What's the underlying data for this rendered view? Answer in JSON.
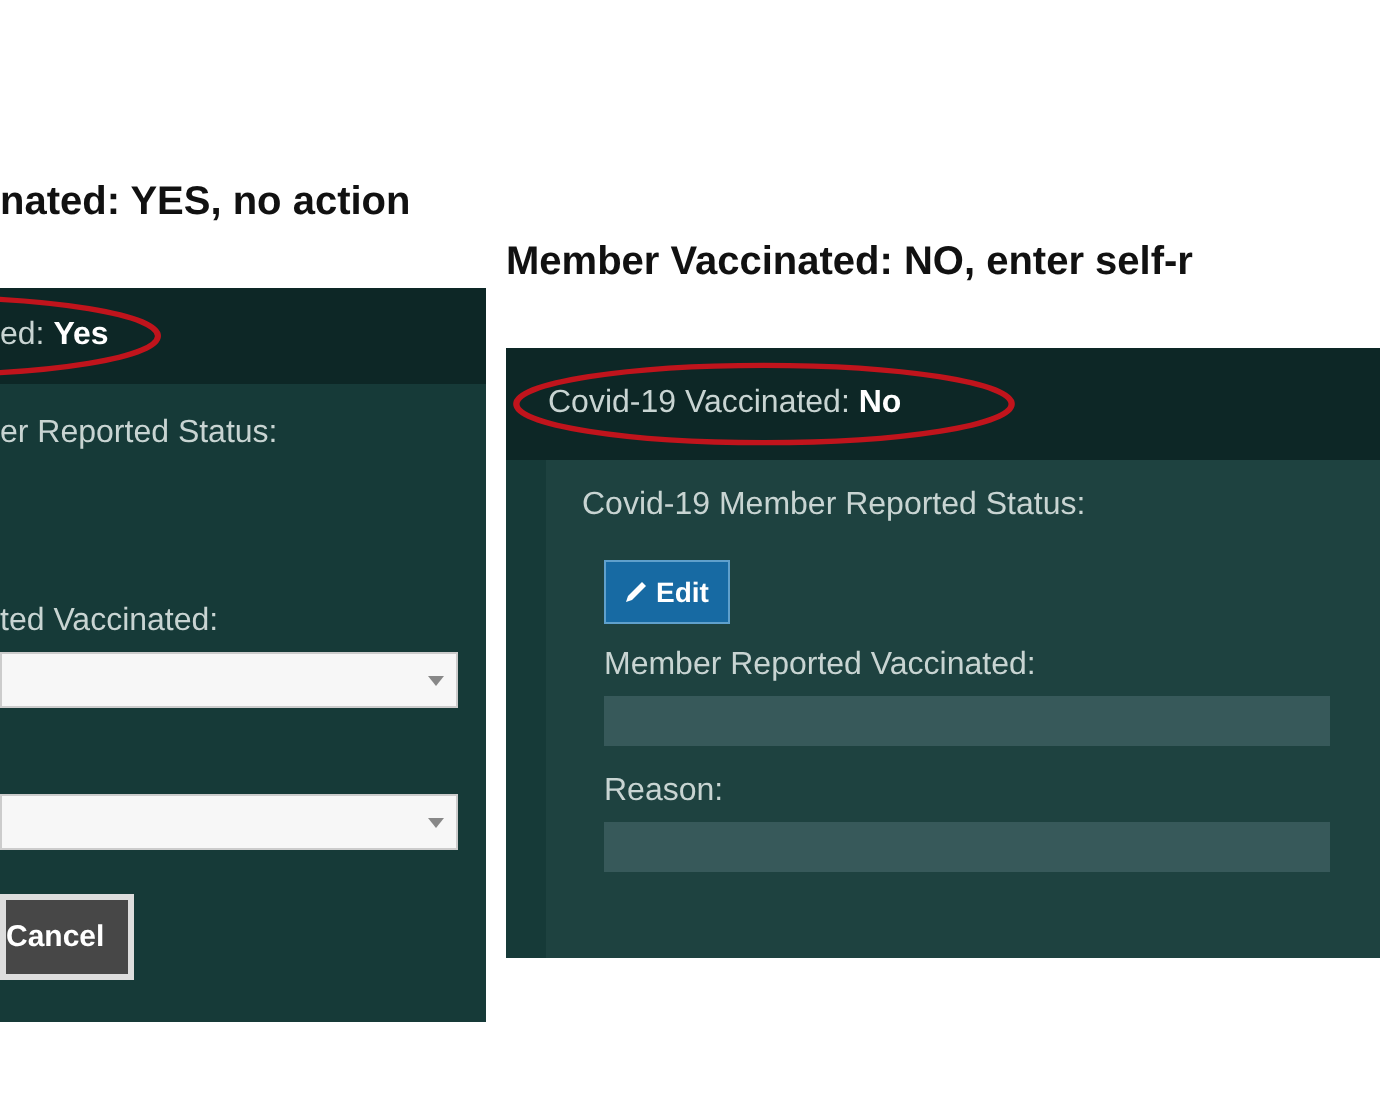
{
  "panels": [
    {
      "caption": "nated: YES, no action",
      "header": {
        "text": "ed: **Yes**",
        "circled": true
      },
      "section_label": "er Reported Status:",
      "fields": [
        {
          "kind": "dropdown",
          "label": "ted Vaccinated:"
        },
        {
          "kind": "dropdown"
        }
      ],
      "buttons": [
        "Cancel"
      ]
    },
    {
      "caption": "Member Vaccinated: NO, enter self-r",
      "header": {
        "text": "Covid-19 Vaccinated: **No**",
        "circled": true
      },
      "section_label": "Covid-19 Member Reported Status:",
      "edit_button": "Edit",
      "fields": [
        {
          "kind": "readonly",
          "label": "Member Reported Vaccinated:"
        },
        {
          "kind": "readonly",
          "label": "Reason:"
        }
      ]
    }
  ]
}
